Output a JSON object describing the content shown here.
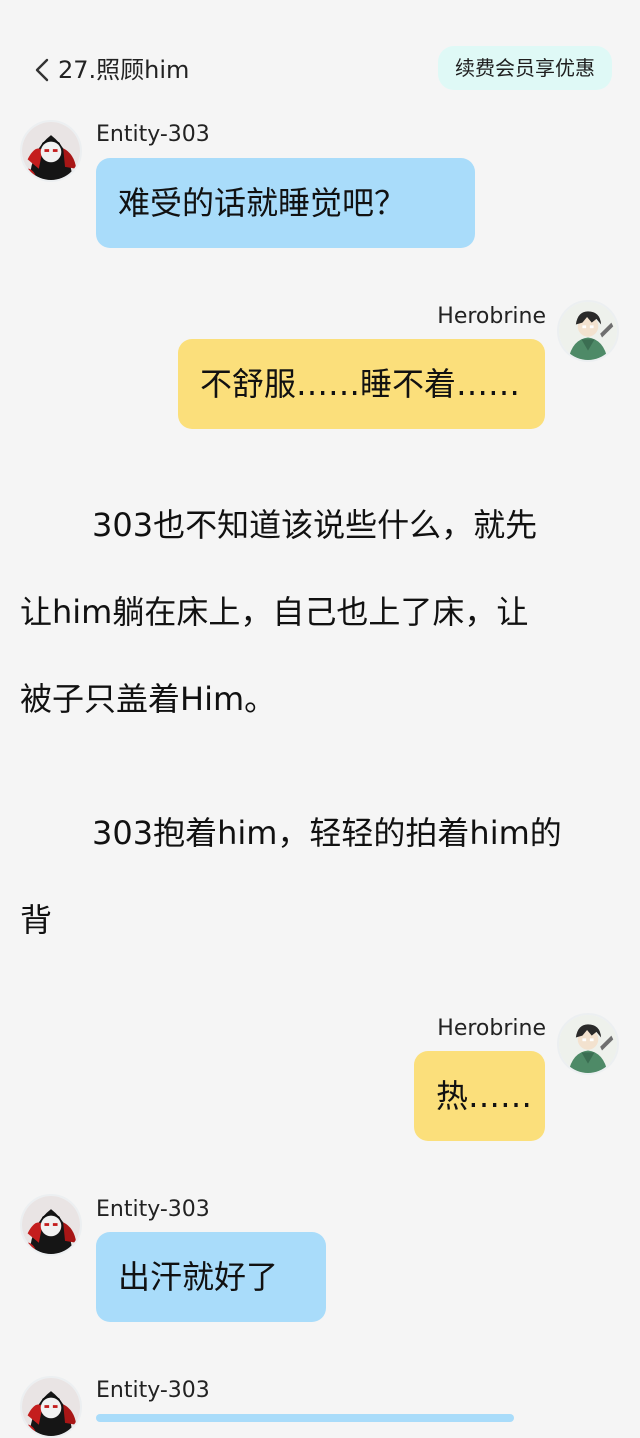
{
  "header": {
    "title": "27.照顾him",
    "vip_button": "续费会员享优惠"
  },
  "messages": [
    {
      "speaker": "Entity-303",
      "text": "难受的话就睡觉吧？"
    },
    {
      "speaker": "Herobrine",
      "text": "不舒服……睡不着……"
    },
    {
      "speaker": "Herobrine",
      "text": "热……"
    },
    {
      "speaker": "Entity-303",
      "text": "出汗就好了"
    },
    {
      "speaker": "Entity-303",
      "text": ""
    }
  ],
  "narration": [
    {
      "lines": [
        "303也不知道该说些什么，就先",
        "让him躺在床上，自己也上了床，让",
        "被子只盖着Him。"
      ]
    },
    {
      "lines": [
        "303抱着him，轻轻的拍着him的",
        "背"
      ]
    }
  ],
  "colors": {
    "background": "#f5f5f5",
    "left_bubble": "#a9dcfa",
    "right_bubble": "#fbdf7b",
    "vip_bg": "#dff9f6"
  },
  "icons": {
    "back": "chevron-left-icon",
    "entity_avatar": "entity-303-avatar",
    "herobrine_avatar": "herobrine-avatar"
  }
}
